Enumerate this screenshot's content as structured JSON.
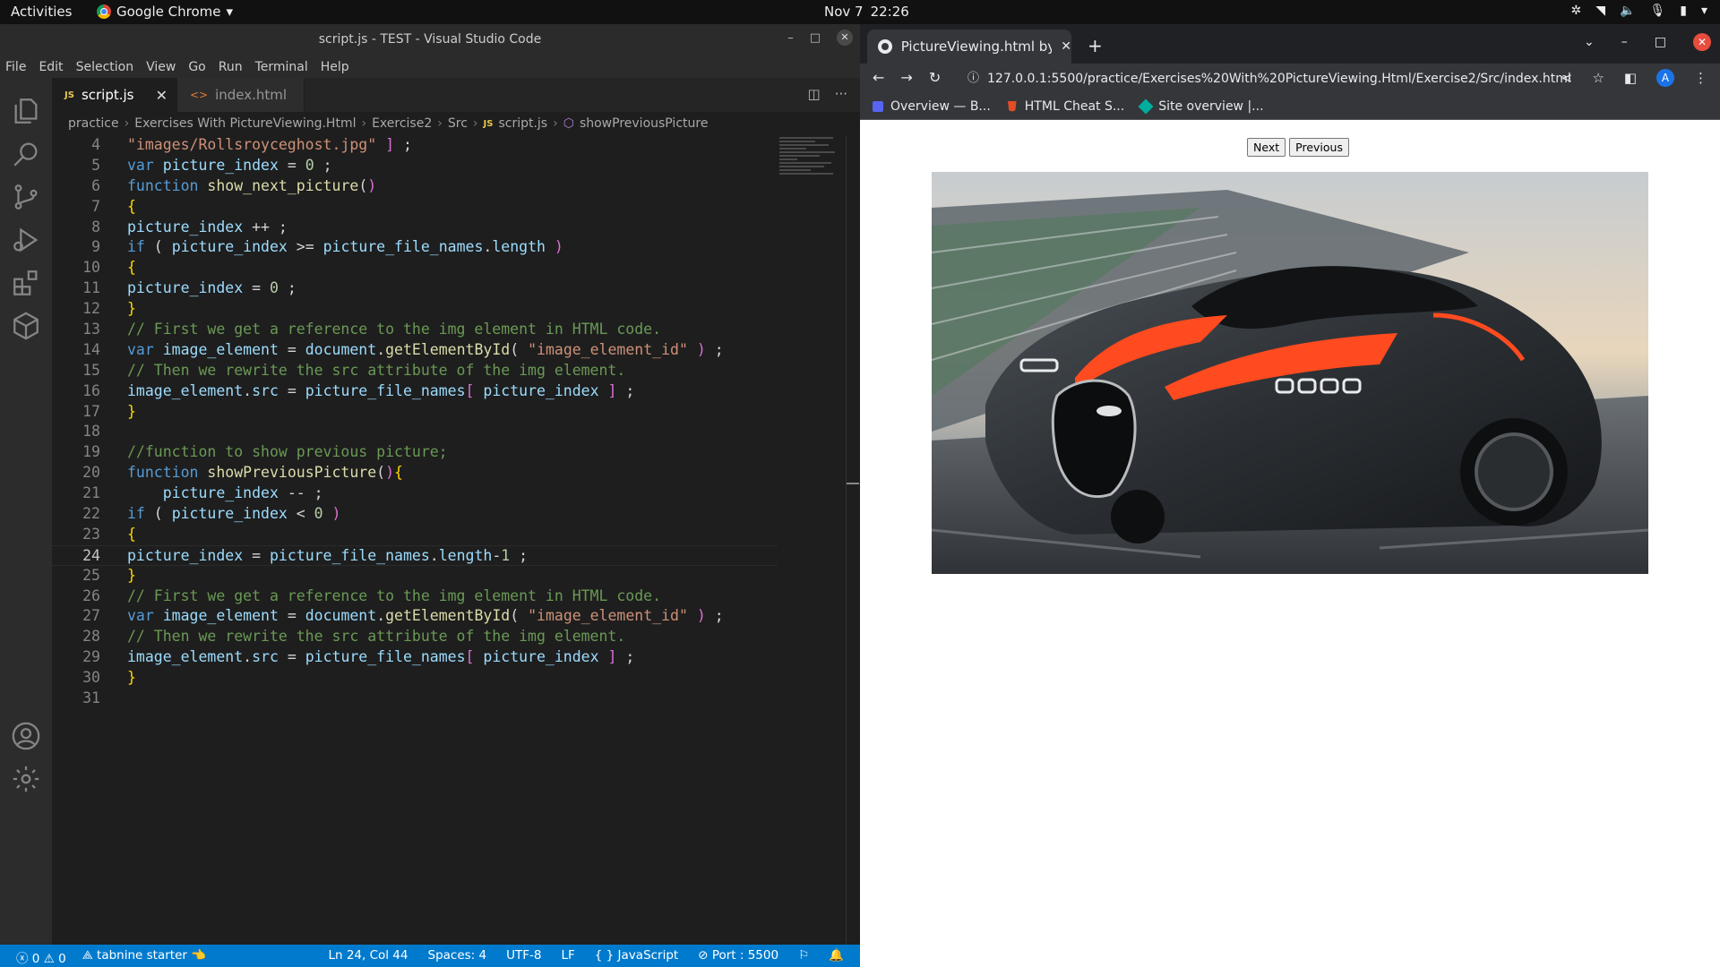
{
  "topbar": {
    "activities": "Activities",
    "app_name": "Google Chrome",
    "date": "Nov 7",
    "time": "22:26"
  },
  "vscode": {
    "title": "script.js - TEST - Visual Studio Code",
    "menu": [
      "File",
      "Edit",
      "Selection",
      "View",
      "Go",
      "Run",
      "Terminal",
      "Help"
    ],
    "tabs": [
      {
        "label": "script.js",
        "icon": "JS"
      },
      {
        "label": "index.html",
        "icon": "<>"
      }
    ],
    "breadcrumb": {
      "parts": [
        "practice",
        "Exercises With PictureViewing.Html",
        "Exercise2",
        "Src"
      ],
      "file": "script.js",
      "symbol": "showPreviousPicture"
    },
    "code_lines": [
      {
        "n": "4",
        "text": "\"images/Rollsroyceghost.jpg\" ] ;"
      },
      {
        "n": "5",
        "text": "var picture_index = 0 ;"
      },
      {
        "n": "6",
        "text": "function show_next_picture()"
      },
      {
        "n": "7",
        "text": "{"
      },
      {
        "n": "8",
        "text": "picture_index ++ ;"
      },
      {
        "n": "9",
        "text": "if ( picture_index >= picture_file_names.length )"
      },
      {
        "n": "10",
        "text": "{"
      },
      {
        "n": "11",
        "text": "picture_index = 0 ;"
      },
      {
        "n": "12",
        "text": "}"
      },
      {
        "n": "13",
        "text": "// First we get a reference to the img element in HTML code."
      },
      {
        "n": "14",
        "text": "var image_element = document.getElementById( \"image_element_id\" ) ;"
      },
      {
        "n": "15",
        "text": "// Then we rewrite the src attribute of the img element."
      },
      {
        "n": "16",
        "text": "image_element.src = picture_file_names[ picture_index ] ;"
      },
      {
        "n": "17",
        "text": "}"
      },
      {
        "n": "18",
        "text": ""
      },
      {
        "n": "19",
        "text": "//function to show previous picture;"
      },
      {
        "n": "20",
        "text": "function showPreviousPicture(){"
      },
      {
        "n": "21",
        "text": "    picture_index -- ;"
      },
      {
        "n": "22",
        "text": "if ( picture_index < 0 )"
      },
      {
        "n": "23",
        "text": "{"
      },
      {
        "n": "24",
        "text": "picture_index = picture_file_names.length-1 ;"
      },
      {
        "n": "25",
        "text": "}"
      },
      {
        "n": "26",
        "text": "// First we get a reference to the img element in HTML code."
      },
      {
        "n": "27",
        "text": "var image_element = document.getElementById( \"image_element_id\" ) ;"
      },
      {
        "n": "28",
        "text": "// Then we rewrite the src attribute of the img element."
      },
      {
        "n": "29",
        "text": "image_element.src = picture_file_names[ picture_index ] ;"
      },
      {
        "n": "30",
        "text": "}"
      },
      {
        "n": "31",
        "text": ""
      }
    ],
    "current_line": "24",
    "status": {
      "errors": "0",
      "warnings": "0",
      "tabnine": "tabnine starter",
      "position": "Ln 24, Col 44",
      "spaces": "Spaces: 4",
      "encoding": "UTF-8",
      "eol": "LF",
      "language": "JavaScript",
      "port": "Port : 5500"
    }
  },
  "chrome": {
    "tab_title": "PictureViewing.html by K",
    "url": "127.0.0.1:5500/practice/Exercises%20With%20PictureViewing.Html/Exercise2/Src/index.html",
    "profile_initial": "A",
    "bookmarks": [
      "Overview — B...",
      "HTML Cheat S...",
      "Site overview |..."
    ],
    "page": {
      "next_label": "Next",
      "previous_label": "Previous"
    }
  },
  "colors": {
    "vscode_statusbar": "#007acc",
    "chrome_frame": "#35363a",
    "car_accent": "#ff4b1f"
  }
}
